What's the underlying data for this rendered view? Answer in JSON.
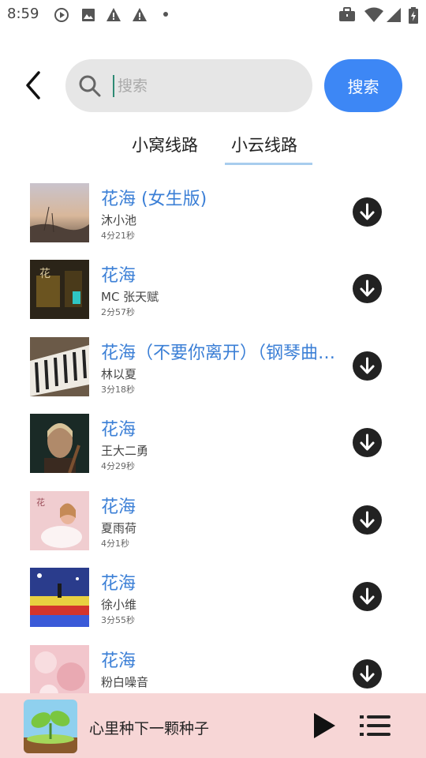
{
  "status_bar": {
    "time": "8:59"
  },
  "search": {
    "placeholder": "搜索",
    "value": "",
    "button_label": "搜索"
  },
  "tabs": [
    {
      "label": "小窝线路",
      "active": false
    },
    {
      "label": "小云线路",
      "active": true
    }
  ],
  "songs": [
    {
      "title": "花海 (女生版)",
      "artist": "沐小池",
      "duration": "4分21秒"
    },
    {
      "title": "花海",
      "artist": "MC 张天赋",
      "duration": "2分57秒"
    },
    {
      "title": "花海（不要你离开）（钢琴曲…",
      "artist": "林以夏",
      "duration": "3分18秒"
    },
    {
      "title": "花海",
      "artist": "王大二勇",
      "duration": "4分29秒"
    },
    {
      "title": "花海",
      "artist": "夏雨荷",
      "duration": "4分1秒"
    },
    {
      "title": "花海",
      "artist": "徐小维",
      "duration": "3分55秒"
    },
    {
      "title": "花海",
      "artist": "粉白噪音",
      "duration": ""
    }
  ],
  "player": {
    "now_playing": "心里种下一颗种子"
  },
  "colors": {
    "accent": "#3d87f5",
    "title_blue": "#3b7fd6",
    "player_bg": "#f7d6d6"
  }
}
